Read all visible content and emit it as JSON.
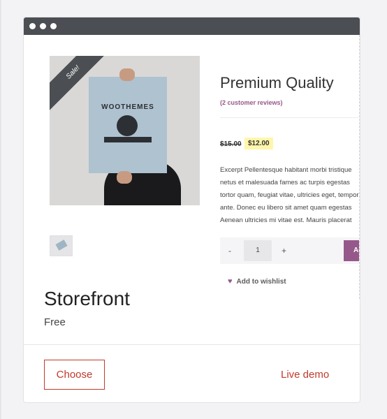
{
  "window": {
    "controls": [
      "dot-1",
      "dot-2",
      "dot-3"
    ]
  },
  "product": {
    "sale_badge": "Sale!",
    "poster_text": "WOOTHEMES",
    "title": "Premium Quality",
    "reviews": "(2 customer reviews)",
    "price_old": "$15.00",
    "price_new": "$12.00",
    "excerpt_lines": [
      "Excerpt Pellentesque habitant morbi tristique",
      "netus et malesuada fames ac turpis egestas",
      "tortor quam, feugiat vitae, ultricies eget, tempor",
      "ante. Donec eu libero sit amet quam egestas",
      "Aenean ultricies mi vitae est. Mauris placerat"
    ],
    "qty_minus": "-",
    "quantity": "1",
    "qty_plus": "+",
    "add_button": "Ad",
    "wishlist": "Add to wishlist"
  },
  "theme": {
    "name": "Storefront",
    "price": "Free"
  },
  "actions": {
    "choose": "Choose",
    "live_demo": "Live demo"
  },
  "colors": {
    "titlebar": "#4b4e52",
    "accent": "#c0392b",
    "woo_purple": "#96588a",
    "sale_highlight": "#fff6ab"
  }
}
